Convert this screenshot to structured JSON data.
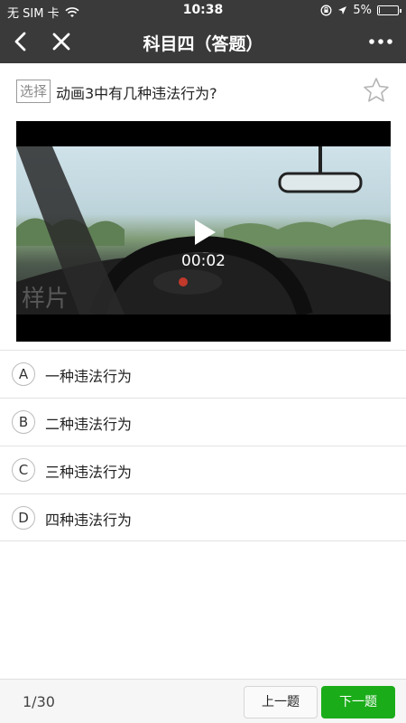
{
  "status_bar": {
    "carrier": "无 SIM 卡",
    "time": "10:38",
    "battery_text": "5%",
    "battery_level": 0.05
  },
  "nav": {
    "title": "科目四（答题）"
  },
  "question": {
    "type_label": "选择",
    "text": "动画3中有几种违法行为?"
  },
  "video": {
    "duration": "00:02",
    "watermark": "样片"
  },
  "options": [
    {
      "letter": "A",
      "text": "一种违法行为"
    },
    {
      "letter": "B",
      "text": "二种违法行为"
    },
    {
      "letter": "C",
      "text": "三种违法行为"
    },
    {
      "letter": "D",
      "text": "四种违法行为"
    }
  ],
  "bottom": {
    "progress": "1/30",
    "prev_label": "上一题",
    "next_label": "下一题"
  },
  "colors": {
    "bar": "#3a3a3a",
    "accent": "#1aad19"
  },
  "icons": [
    "back-icon",
    "close-icon",
    "more-icon",
    "star-icon",
    "play-icon",
    "wifi-icon",
    "location-icon",
    "lock-rotation-icon",
    "battery-icon"
  ]
}
